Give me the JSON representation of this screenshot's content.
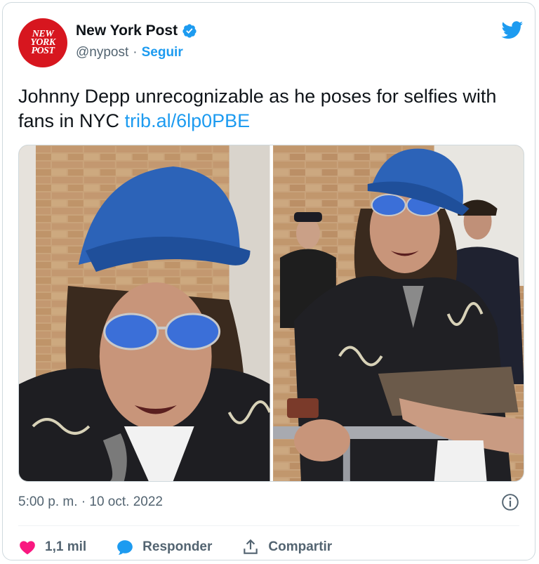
{
  "account": {
    "name": "New York Post",
    "handle": "@nypost",
    "separator": "·",
    "follow_label": "Seguir",
    "avatar_lines": [
      "NEW",
      "YORK",
      "POST"
    ]
  },
  "tweet": {
    "text": "Johnny Depp unrecognizable as he poses for selfies with fans in NYC ",
    "link": "trib.al/6lp0PBE"
  },
  "media": {
    "photos": [
      {
        "alt": "Johnny Depp in blue cap and mirrored sunglasses, close-up"
      },
      {
        "alt": "Johnny Depp signing autographs for fans behind a barrier"
      }
    ]
  },
  "meta": {
    "timestamp": "5:00 p. m. · 10 oct. 2022"
  },
  "actions": {
    "likes": "1,1 mil",
    "reply_label": "Responder",
    "share_label": "Compartir"
  },
  "colors": {
    "accent": "#1d9bf0",
    "like": "#f91880",
    "brand_red": "#d7161f"
  }
}
